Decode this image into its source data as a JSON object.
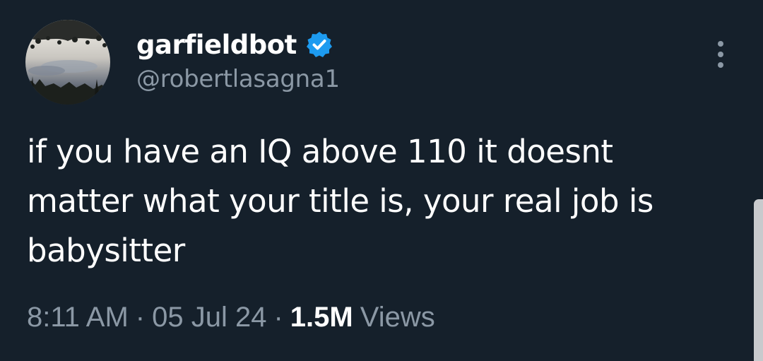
{
  "author": {
    "display_name": "garfieldbot",
    "handle": "@robertlasagna1",
    "verified": true
  },
  "tweet": {
    "text_lines": [
      "if you have an IQ above 110 it doesnt",
      "matter what your title is, your real job is",
      "babysitter"
    ]
  },
  "meta": {
    "time": "8:11 AM",
    "separator": "·",
    "date": "05 Jul 24",
    "views_count": "1.5M",
    "views_label": "Views"
  },
  "icons": {
    "verified": "verified-badge-icon",
    "more": "more-vertical-icon"
  },
  "colors": {
    "background": "#15202b",
    "text_primary": "#ffffff",
    "text_secondary": "#8b98a5",
    "verified_blue": "#1d9bf0"
  }
}
